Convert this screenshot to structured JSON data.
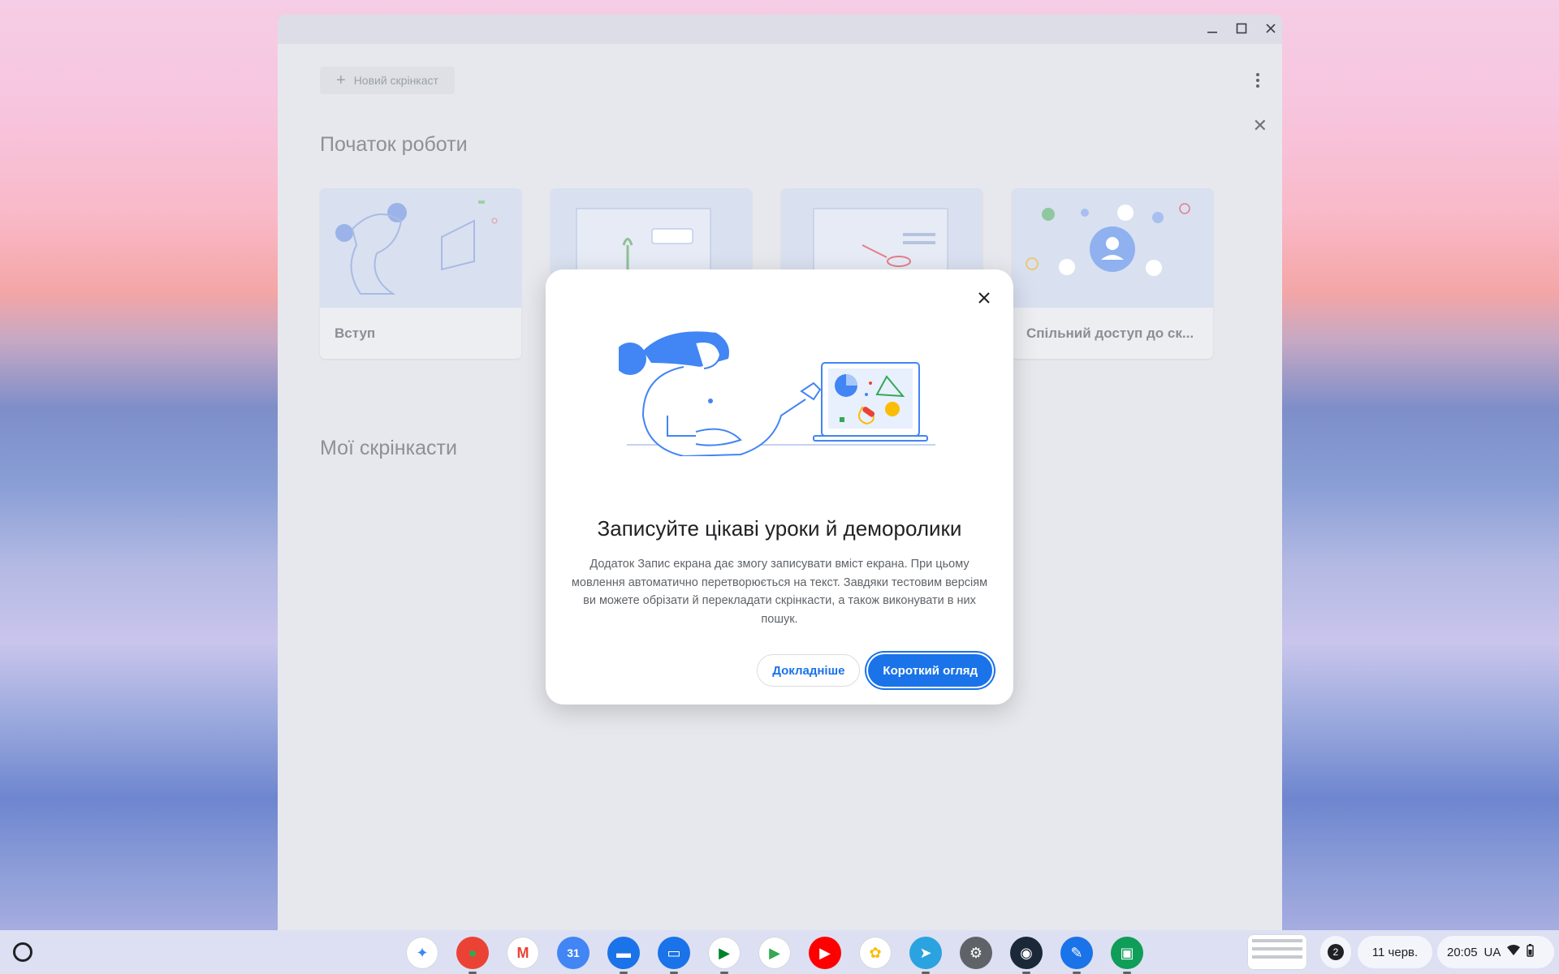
{
  "window": {
    "minimize_icon": "minimize-icon",
    "maximize_icon": "maximize-icon",
    "close_icon": "close-icon"
  },
  "app": {
    "new_button_label": "Новий скрінкаст",
    "getting_started_title": "Початок роботи",
    "my_screencasts_title": "Мої скрінкасти",
    "cards": [
      {
        "label": "Вступ"
      },
      {
        "label": ""
      },
      {
        "label": ""
      },
      {
        "label": "Спільний доступ до ск..."
      }
    ]
  },
  "dialog": {
    "title": "Записуйте цікаві уроки й деморолики",
    "body": "Додаток Запис екрана дає змогу записувати вміст екрана. При цьому мовлення автоматично перетворюється на текст. Завдяки тестовим версіям ви можете обрізати й перекладати скрінкасти, а також виконувати в них пошук.",
    "secondary_label": "Докладніше",
    "primary_label": "Короткий огляд"
  },
  "shelf": {
    "apps": [
      {
        "name": "gemini-icon",
        "color": "#ffffff",
        "glyph": "✦",
        "fg": "#4285f4"
      },
      {
        "name": "chrome-icon",
        "color": "#ea4335",
        "glyph": "●",
        "fg": "#34a853"
      },
      {
        "name": "gmail-icon",
        "color": "#ffffff",
        "glyph": "M",
        "fg": "#ea4335"
      },
      {
        "name": "calendar-icon",
        "color": "#4285f4",
        "glyph": "31",
        "fg": "#ffffff"
      },
      {
        "name": "files-icon",
        "color": "#1a73e8",
        "glyph": "▬",
        "fg": "#ffffff"
      },
      {
        "name": "messages-icon",
        "color": "#1a73e8",
        "glyph": "▭",
        "fg": "#ffffff"
      },
      {
        "name": "meet-icon",
        "color": "#ffffff",
        "glyph": "▶",
        "fg": "#00832d"
      },
      {
        "name": "play-store-icon",
        "color": "#ffffff",
        "glyph": "▶",
        "fg": "#34a853"
      },
      {
        "name": "youtube-icon",
        "color": "#ff0000",
        "glyph": "▶",
        "fg": "#ffffff"
      },
      {
        "name": "photos-icon",
        "color": "#ffffff",
        "glyph": "✿",
        "fg": "#fbbc04"
      },
      {
        "name": "telegram-icon",
        "color": "#2aa3e0",
        "glyph": "➤",
        "fg": "#ffffff"
      },
      {
        "name": "settings-icon",
        "color": "#5f6368",
        "glyph": "⚙",
        "fg": "#ffffff"
      },
      {
        "name": "steam-icon",
        "color": "#1b2838",
        "glyph": "◉",
        "fg": "#ffffff"
      },
      {
        "name": "screencast-icon",
        "color": "#1a73e8",
        "glyph": "✎",
        "fg": "#ffffff"
      },
      {
        "name": "classroom-icon",
        "color": "#0f9d58",
        "glyph": "▣",
        "fg": "#ffffff"
      }
    ],
    "notification_count": "2",
    "date": "11 черв.",
    "time": "20:05",
    "input_method": "UA"
  }
}
